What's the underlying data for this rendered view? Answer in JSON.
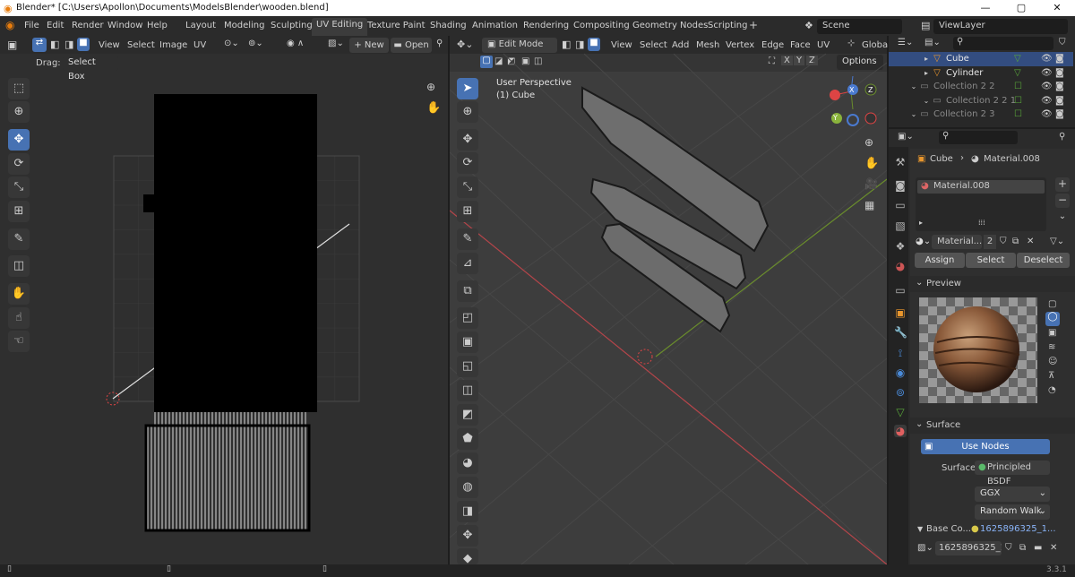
{
  "window": {
    "title": "Blender* [C:\\Users\\Apollon\\Documents\\ModelsBlender\\wooden.blend]",
    "min": "—",
    "max": "▢",
    "close": "✕"
  },
  "menu": [
    "File",
    "Edit",
    "Render",
    "Window",
    "Help"
  ],
  "workspaces": [
    "Layout",
    "Modeling",
    "Sculpting",
    "UV Editing",
    "Texture Paint",
    "Shading",
    "Animation",
    "Rendering",
    "Compositing",
    "Geometry Nodes",
    "Scripting"
  ],
  "add_tab": "+",
  "scene": "Scene",
  "view_layer": "ViewLayer",
  "uv_editor": {
    "menu": [
      "View",
      "Select",
      "Image",
      "UV"
    ],
    "new_label": "New",
    "open_label": "Open",
    "drag_label": "Drag:",
    "drag_value": "Select Box"
  },
  "viewport": {
    "mode": "Edit Mode",
    "menu": [
      "View",
      "Select",
      "Add",
      "Mesh",
      "Vertex",
      "Edge",
      "Face",
      "UV"
    ],
    "orientation": "Global",
    "perspective": "User Perspective",
    "object_label": "(1) Cube",
    "x": "X",
    "y": "Y",
    "z": "Z",
    "options": "Options",
    "gizmo_x": "X",
    "gizmo_y": "Y",
    "gizmo_z": "Z"
  },
  "outliner": {
    "items": [
      {
        "label": "Cube",
        "indent": 2,
        "selected": true,
        "dim": false
      },
      {
        "label": "Cylinder",
        "indent": 2,
        "selected": false,
        "dim": false
      },
      {
        "label": "Collection 2 2",
        "indent": 1,
        "selected": false,
        "dim": true
      },
      {
        "label": "Collection 2 2 1",
        "indent": 2,
        "selected": false,
        "dim": true
      },
      {
        "label": "Collection 2 3",
        "indent": 1,
        "selected": false,
        "dim": true
      }
    ]
  },
  "properties": {
    "breadcrumb_object": "Cube",
    "breadcrumb_material": "Material.008",
    "slot": "Material.008",
    "material_name": "Material...",
    "users": "2",
    "assign": "Assign",
    "select": "Select",
    "deselect": "Deselect",
    "preview_label": "Preview",
    "surface_label": "Surface",
    "use_nodes": "Use Nodes",
    "surface_field": "Surface",
    "surface_value": "Principled BSDF",
    "distribution": "GGX",
    "subsurface": "Random Walk",
    "base_color_label": "Base Co...",
    "base_color_value": "1625896325_1...",
    "image_name": "1625896325_1..."
  },
  "status": {
    "version": "3.3.1"
  }
}
